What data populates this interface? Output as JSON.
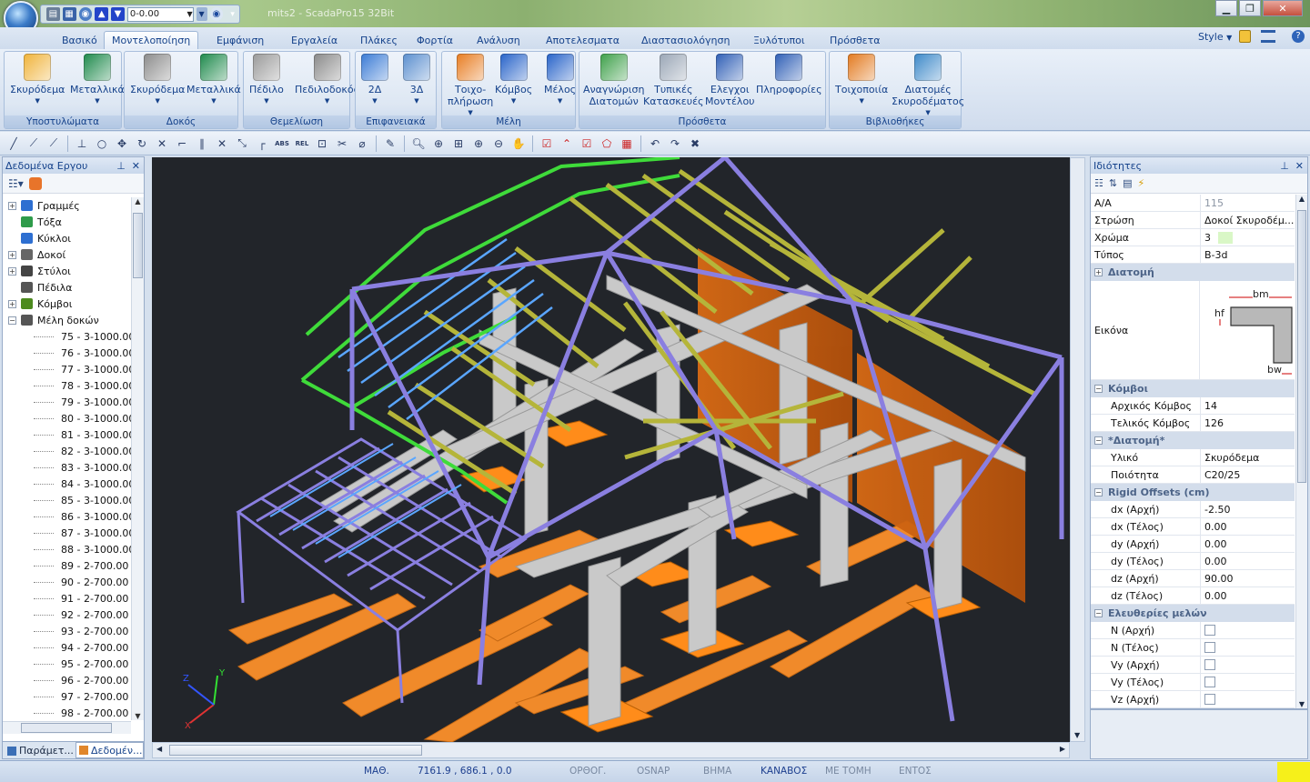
{
  "window": {
    "title": "mits2 - ScadaPro15 32Bit",
    "layer_value": "0-0.00"
  },
  "tabs": [
    "Βασικό",
    "Μοντελοποίηση",
    "Εμφάνιση",
    "Εργαλεία",
    "Πλάκες",
    "Φορτία",
    "Ανάλυση",
    "Αποτελεσματα",
    "Διαστασιολόγηση",
    "Ξυλότυποι",
    "Πρόσθετα"
  ],
  "style_label": "Style",
  "ribbon": {
    "groups": [
      {
        "label": "Υποστυλώματα",
        "buttons": [
          "Σκυρόδεμα",
          "Μεταλλικά"
        ]
      },
      {
        "label": "Δοκός",
        "buttons": [
          "Σκυρόδεμα",
          "Μεταλλικά"
        ]
      },
      {
        "label": "Θεμελίωση",
        "buttons": [
          "Πέδιλο",
          "Πεδιλοδοκός"
        ]
      },
      {
        "label": "Επιφανειακά",
        "buttons": [
          "2Δ",
          "3Δ"
        ]
      },
      {
        "label": "Μέλη",
        "buttons": [
          "Τοιχο-\nπλήρωση",
          "Κόμβος",
          "Μέλος"
        ]
      },
      {
        "label": "Πρόσθετα",
        "buttons": [
          "Αναγνώριση\nΔιατομών",
          "Τυπικές\nΚατασκευές",
          "Ελεγχοι\nΜοντέλου",
          "Πληροφορίες"
        ]
      },
      {
        "label": "Βιβλιοθήκες",
        "buttons": [
          "Τοιχοποιία",
          "Διατομές\nΣκυροδέματος"
        ]
      }
    ]
  },
  "left_panel": {
    "title": "Δεδομένα Εργου",
    "tree": [
      {
        "label": "Γραμμές",
        "level": 0,
        "exp": "+",
        "icon": "line"
      },
      {
        "label": "Τόξα",
        "level": 0,
        "exp": "",
        "icon": "arc"
      },
      {
        "label": "Κύκλοι",
        "level": 0,
        "exp": "",
        "icon": "circle"
      },
      {
        "label": "Δοκοί",
        "level": 0,
        "exp": "+",
        "icon": "beam"
      },
      {
        "label": "Στύλοι",
        "level": 0,
        "exp": "+",
        "icon": "column"
      },
      {
        "label": "Πέδιλα",
        "level": 0,
        "exp": "",
        "icon": "footing"
      },
      {
        "label": "Κόμβοι",
        "level": 0,
        "exp": "+",
        "icon": "node"
      },
      {
        "label": "Μέλη δοκών",
        "level": 0,
        "exp": "−",
        "icon": "member"
      },
      {
        "label": "75 - 3-1000.00",
        "level": 1
      },
      {
        "label": "76 - 3-1000.00",
        "level": 1
      },
      {
        "label": "77 - 3-1000.00",
        "level": 1
      },
      {
        "label": "78 - 3-1000.00",
        "level": 1
      },
      {
        "label": "79 - 3-1000.00",
        "level": 1
      },
      {
        "label": "80 - 3-1000.00",
        "level": 1
      },
      {
        "label": "81 - 3-1000.00",
        "level": 1
      },
      {
        "label": "82 - 3-1000.00",
        "level": 1
      },
      {
        "label": "83 - 3-1000.00",
        "level": 1
      },
      {
        "label": "84 - 3-1000.00",
        "level": 1
      },
      {
        "label": "85 - 3-1000.00",
        "level": 1
      },
      {
        "label": "86 - 3-1000.00",
        "level": 1
      },
      {
        "label": "87 - 3-1000.00",
        "level": 1
      },
      {
        "label": "88 - 3-1000.00",
        "level": 1
      },
      {
        "label": "89 - 2-700.00",
        "level": 1
      },
      {
        "label": "90 - 2-700.00",
        "level": 1
      },
      {
        "label": "91 - 2-700.00",
        "level": 1
      },
      {
        "label": "92 - 2-700.00",
        "level": 1
      },
      {
        "label": "93 - 2-700.00",
        "level": 1
      },
      {
        "label": "94 - 2-700.00",
        "level": 1
      },
      {
        "label": "95 - 2-700.00",
        "level": 1
      },
      {
        "label": "96 - 2-700.00",
        "level": 1
      },
      {
        "label": "97 - 2-700.00",
        "level": 1
      },
      {
        "label": "98 - 2-700.00",
        "level": 1
      }
    ],
    "bottom_tabs": [
      "Παράμετ...",
      "Δεδομέν..."
    ]
  },
  "viewport": {
    "axes": {
      "x": "X",
      "y": "Y",
      "z": "Z"
    }
  },
  "properties": {
    "title": "Ιδιότητες",
    "rows": [
      {
        "type": "prop",
        "name": "Α/Α",
        "value": "115",
        "muted": true
      },
      {
        "type": "prop",
        "name": "Στρώση",
        "value": "Δοκοί Σκυροδέμ..."
      },
      {
        "type": "prop",
        "name": "Χρώμα",
        "value": "3",
        "swatch": "#d9f7c6"
      },
      {
        "type": "prop",
        "name": "Τύπος",
        "value": "B-3d"
      },
      {
        "type": "cat",
        "name": "Διατομή",
        "exp": "+"
      },
      {
        "type": "image",
        "name": "Εικόνα",
        "labels": {
          "bm": "bm",
          "hf": "hf",
          "bw": "bw"
        }
      },
      {
        "type": "cat",
        "name": "Κόμβοι",
        "exp": "−"
      },
      {
        "type": "prop",
        "name": "Αρχικός Κόμβος",
        "value": "14",
        "indent": true
      },
      {
        "type": "prop",
        "name": "Τελικός Κόμβος",
        "value": "126",
        "indent": true
      },
      {
        "type": "cat",
        "name": "*Διατομή*",
        "exp": "−"
      },
      {
        "type": "prop",
        "name": "Υλικό",
        "value": "Σκυρόδεμα",
        "indent": true
      },
      {
        "type": "prop",
        "name": "Ποιότητα",
        "value": "C20/25",
        "indent": true
      },
      {
        "type": "cat",
        "name": "Rigid Offsets (cm)",
        "exp": "−"
      },
      {
        "type": "prop",
        "name": "dx (Αρχή)",
        "value": "-2.50",
        "indent": true
      },
      {
        "type": "prop",
        "name": "dx (Τέλος)",
        "value": "0.00",
        "indent": true
      },
      {
        "type": "prop",
        "name": "dy (Αρχή)",
        "value": "0.00",
        "indent": true
      },
      {
        "type": "prop",
        "name": "dy (Τέλος)",
        "value": "0.00",
        "indent": true
      },
      {
        "type": "prop",
        "name": "dz (Αρχή)",
        "value": "90.00",
        "indent": true
      },
      {
        "type": "prop",
        "name": "dz (Τέλος)",
        "value": "0.00",
        "indent": true
      },
      {
        "type": "cat",
        "name": "Ελευθερίες μελών",
        "exp": "−"
      },
      {
        "type": "check",
        "name": "N (Αρχή)",
        "indent": true
      },
      {
        "type": "check",
        "name": "N (Τέλος)",
        "indent": true
      },
      {
        "type": "check",
        "name": "Vy (Αρχή)",
        "indent": true
      },
      {
        "type": "check",
        "name": "Vy (Τέλος)",
        "indent": true
      },
      {
        "type": "check",
        "name": "Vz (Αρχή)",
        "indent": true
      }
    ]
  },
  "statusbar": {
    "items": [
      {
        "label": "ΜΑΘ.",
        "on": true
      },
      {
        "label": "7161.9 , 686.1 , 0.0",
        "on": true
      },
      {
        "label": "ΟΡΘΟΓ.",
        "on": false
      },
      {
        "label": "OSNAP",
        "on": false
      },
      {
        "label": "ΒΗΜΑ",
        "on": false
      },
      {
        "label": "ΚΑΝΑΒΟΣ",
        "on": true
      },
      {
        "label": "ΜΕ ΤΟΜΗ",
        "on": false
      },
      {
        "label": "ΕΝΤΟΣ",
        "on": false
      }
    ]
  }
}
